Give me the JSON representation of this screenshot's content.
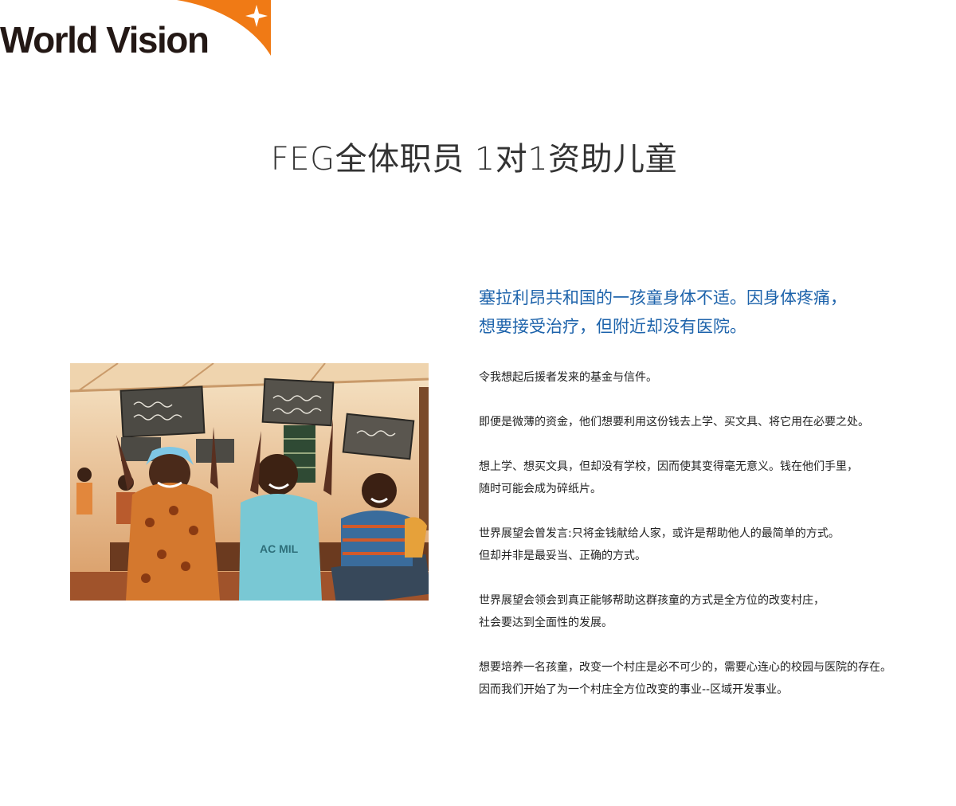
{
  "brand": {
    "logo_text": "World Vision",
    "accent_color": "#f07a15"
  },
  "page": {
    "title": "FEG全体职员 1对1资助儿童"
  },
  "photo": {
    "subject": "children holding up slates in classroom"
  },
  "content": {
    "headline_color": "#1d63ab",
    "headline_lines": [
      "塞拉利昂共和国的一孩童身体不适。因身体疼痛，",
      "想要接受治疗，但附近却没有医院。"
    ],
    "paragraphs": [
      [
        "令我想起后援者发来的基金与信件。"
      ],
      [
        "即便是微薄的资金，他们想要利用这份钱去上学、买文具、将它用在必要之处。"
      ],
      [
        "想上学、想买文具，但却没有学校，因而使其变得毫无意义。钱在他们手里，",
        "随时可能会成为碎纸片。"
      ],
      [
        "世界展望会曾发言:只将金钱献给人家，或许是帮助他人的最简单的方式。",
        "但却并非是最妥当、正确的方式。"
      ],
      [
        "世界展望会领会到真正能够帮助这群孩童的方式是全方位的改变村庄，",
        "社会要达到全面性的发展。"
      ],
      [
        "想要培养一名孩童，改变一个村庄是必不可少的，需要心连心的校园与医院的存在。",
        "因而我们开始了为一个村庄全方位改变的事业--区域开发事业。"
      ]
    ]
  }
}
